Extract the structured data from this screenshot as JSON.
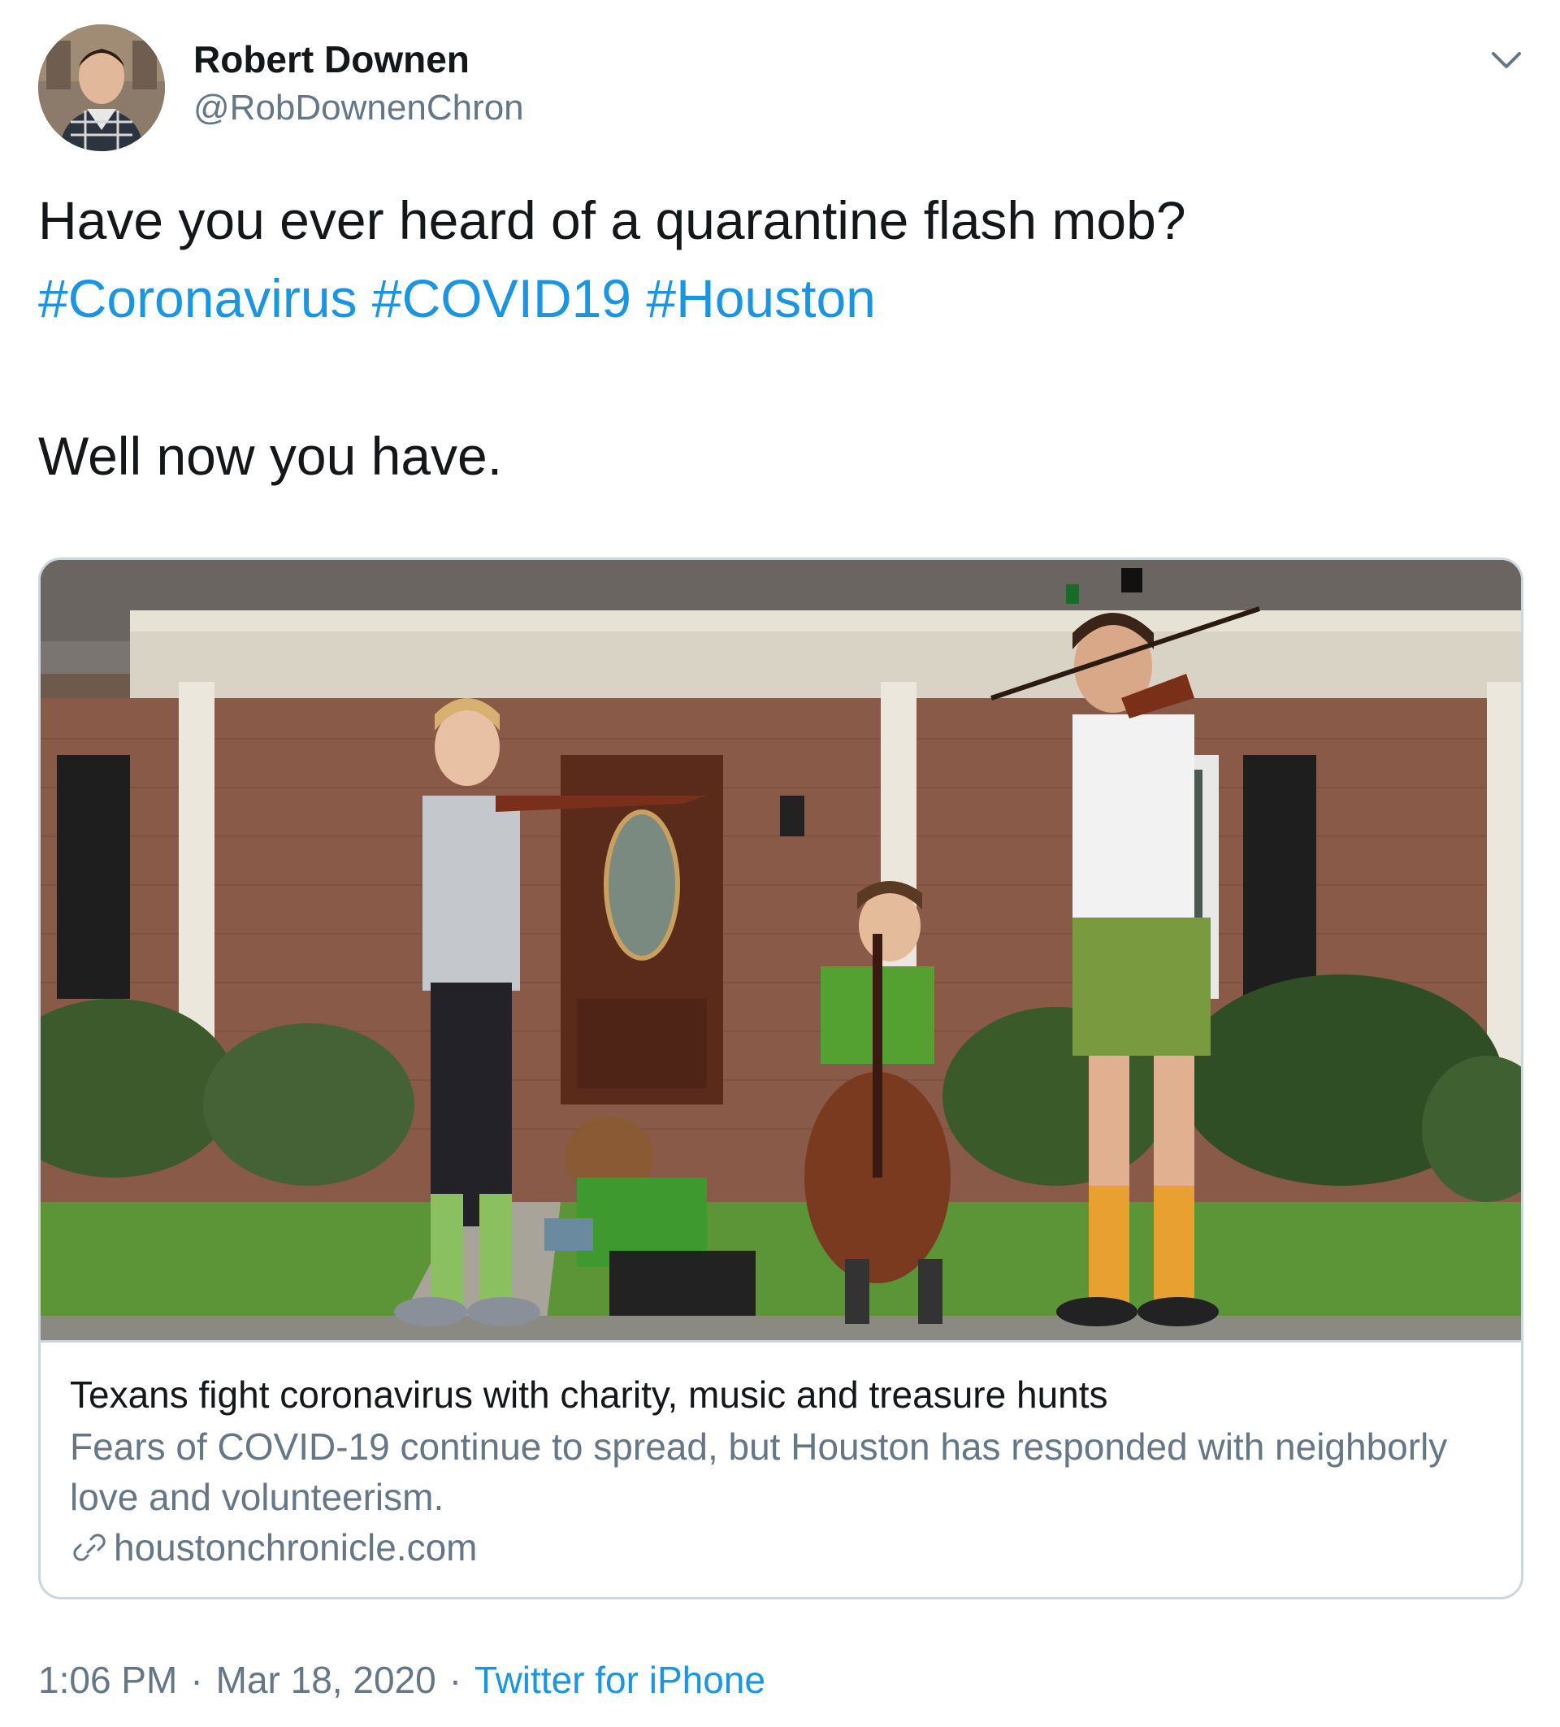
{
  "author": {
    "name": "Robert Downen",
    "handle": "@RobDownenChron"
  },
  "tweet": {
    "line1": "Have you ever heard of a quarantine flash mob?",
    "hashtags": [
      "#Coronavirus",
      "#COVID19",
      "#Houston"
    ],
    "line3": "Well now you have."
  },
  "card": {
    "title": "Texans fight coronavirus with charity, music and treasure hunts",
    "description": "Fears of COVID-19 continue to spread, but Houston has responded with neighborly love and volunteerism.",
    "domain": "houstonchronicle.com"
  },
  "meta": {
    "time": "1:06 PM",
    "date": "Mar 18, 2020",
    "separator": "·",
    "source": "Twitter for iPhone"
  },
  "icons": {
    "caret": "chevron-down-icon",
    "link": "link-icon"
  },
  "colors": {
    "link_blue": "#1b95e0",
    "secondary_text": "#657786",
    "border": "#ccd6dd"
  }
}
